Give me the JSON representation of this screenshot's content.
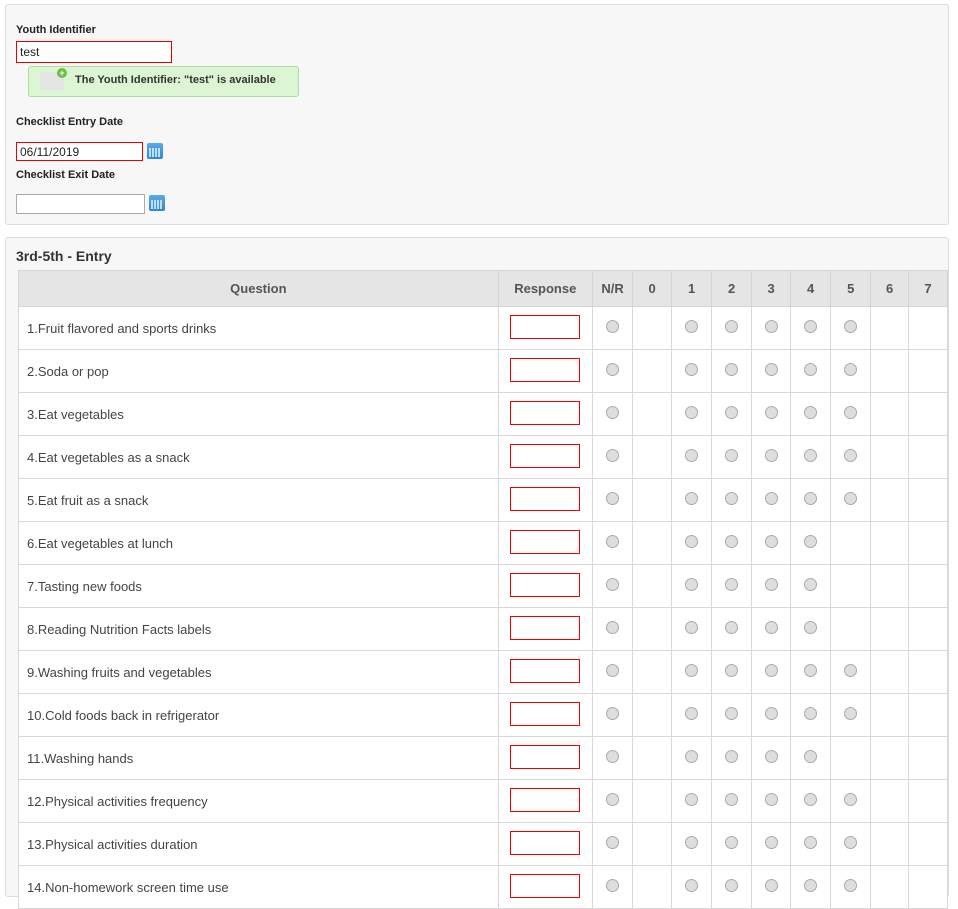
{
  "form": {
    "youth_label": "Youth Identifier",
    "youth_value": "test",
    "availability_message": "The Youth Identifier: \"test\" is available",
    "entry_label": "Checklist Entry Date",
    "entry_value": "06/11/2019",
    "exit_label": "Checklist Exit Date",
    "exit_value": ""
  },
  "checklist": {
    "title": "3rd-5th - Entry",
    "headers": [
      "Question",
      "Response",
      "N/R",
      "0",
      "1",
      "2",
      "3",
      "4",
      "5",
      "6",
      "7"
    ],
    "questions": [
      {
        "label": "1.Fruit flavored and sports drinks",
        "max": 5
      },
      {
        "label": "2.Soda or pop",
        "max": 5
      },
      {
        "label": "3.Eat vegetables",
        "max": 5
      },
      {
        "label": "4.Eat vegetables as a snack",
        "max": 5
      },
      {
        "label": "5.Eat fruit as a snack",
        "max": 5
      },
      {
        "label": "6.Eat vegetables at lunch",
        "max": 4
      },
      {
        "label": "7.Tasting new foods",
        "max": 4
      },
      {
        "label": "8.Reading Nutrition Facts labels",
        "max": 4
      },
      {
        "label": "9.Washing fruits and vegetables",
        "max": 5
      },
      {
        "label": "10.Cold foods back in refrigerator",
        "max": 5
      },
      {
        "label": "11.Washing hands",
        "max": 4
      },
      {
        "label": "12.Physical activities frequency",
        "max": 5
      },
      {
        "label": "13.Physical activities duration",
        "max": 5
      },
      {
        "label": "14.Non-homework screen time use",
        "max": 5
      }
    ]
  }
}
